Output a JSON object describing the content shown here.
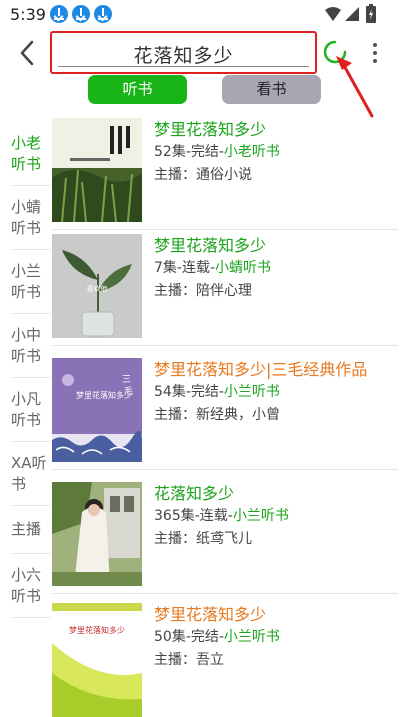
{
  "status_bar": {
    "time": "5:39",
    "icons": [
      "download-icon",
      "download-icon",
      "download-icon",
      "wifi-icon",
      "signal-icon",
      "battery-icon"
    ]
  },
  "header": {
    "search_value": "花落知多少",
    "icons": [
      "back-arrow-icon",
      "refresh-icon",
      "more-vert-icon"
    ]
  },
  "tabs": [
    {
      "label": "听书",
      "active": true
    },
    {
      "label": "看书",
      "active": false
    }
  ],
  "sidebar": {
    "items": [
      {
        "label": "小老听书",
        "active": true
      },
      {
        "label": "小蜻听书",
        "active": false
      },
      {
        "label": "小兰听书",
        "active": false
      },
      {
        "label": "小中听书",
        "active": false
      },
      {
        "label": "小凡听书",
        "active": false
      },
      {
        "label": "XA听书",
        "active": false
      },
      {
        "label": "主播",
        "active": false
      },
      {
        "label": "小六听书",
        "active": false
      }
    ]
  },
  "results": [
    {
      "title": "梦里花落知多少",
      "title_color": "green",
      "episodes": "52集-完结-",
      "source": "小老听书",
      "host": "主播：通俗小说"
    },
    {
      "title": "梦里花落知多少",
      "title_color": "green",
      "episodes": "7集-连载-",
      "source": "小蜻听书",
      "host": "主播：陪伴心理"
    },
    {
      "title": "梦里花落知多少|三毛经典作品",
      "title_color": "orange",
      "episodes": "54集-完结-",
      "source": "小兰听书",
      "host": "主播：新经典，小曾"
    },
    {
      "title": "花落知多少",
      "title_color": "green",
      "episodes": "365集-连载-",
      "source": "小兰听书",
      "host": "主播：纸鸢飞儿"
    },
    {
      "title": "梦里花落知多少",
      "title_color": "orange",
      "episodes": "50集-完结-",
      "source": "小兰听书",
      "host": "主播：吾立"
    }
  ],
  "covers": {
    "c2_text": "喜欢他",
    "c3_text": "梦里花落知多少",
    "c5_text": "梦里花落知多少"
  },
  "colors": {
    "accent_green": "#18b418",
    "highlight_red": "#e02020",
    "title_orange": "#e8791e"
  }
}
